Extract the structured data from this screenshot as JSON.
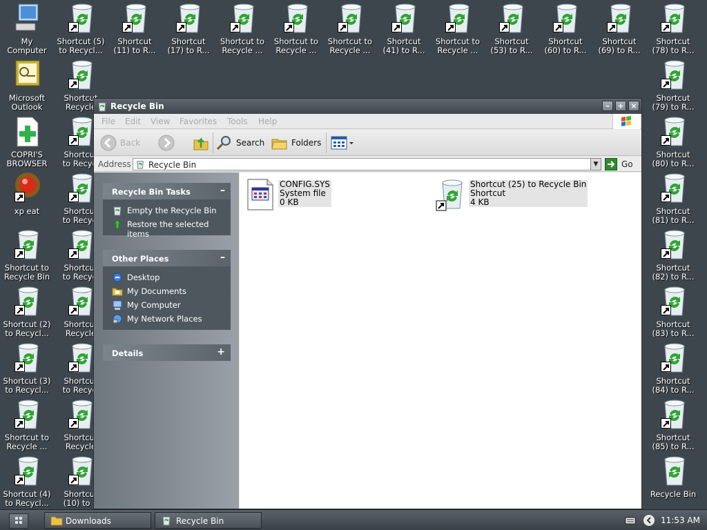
{
  "desktop": {
    "icons": [
      {
        "label": "My\nComputer"
      },
      {
        "label": "Microsoft\nOutlook"
      },
      {
        "label": "COPRI'S\nBROWSER"
      },
      {
        "label": "xp eat"
      },
      {
        "label": "Shortcut to\nRecycle Bin"
      },
      {
        "label": "Shortcut (2)\nto Recycl..."
      },
      {
        "label": "Shortcut (3)\nto Recycl..."
      },
      {
        "label": "Shortcut to\nRecycle ..."
      },
      {
        "label": "Shortcut (4)\nto Recycl..."
      },
      {
        "label": "Shortcut (5)\nto Recycl..."
      },
      {
        "label": "Shortcut\nRecycle"
      },
      {
        "label": "Shortcut\nto Recycl"
      },
      {
        "label": "Shortcut\nto Recycl"
      },
      {
        "label": "Shortcut\nto Recycl"
      },
      {
        "label": "Shortcut\nRecycle"
      },
      {
        "label": "Shortcut\nto Recycl"
      },
      {
        "label": "Shortcut\nRecycle"
      },
      {
        "label": "Shortcut\n(10) to R"
      },
      {
        "label": "Shortcut\n(11) to R..."
      },
      {
        "label": "Shortcut\n(17) to R..."
      },
      {
        "label": "Shortcut to\nRecycle ..."
      },
      {
        "label": "Shortcut to\nRecycle ..."
      },
      {
        "label": "Shortcut to\nRecycle ..."
      },
      {
        "label": "Shortcut\n(41) to R..."
      },
      {
        "label": "Shortcut to\nRecycle ..."
      },
      {
        "label": "Shortcut\n(53) to R..."
      },
      {
        "label": "Shortcut\n(60) to R..."
      },
      {
        "label": "Shortcut\n(69) to R..."
      },
      {
        "label": "Shortcut\n(78) to R..."
      },
      {
        "label": "Shortcut\n(79) to R..."
      },
      {
        "label": "Shortcut\n(80) to R..."
      },
      {
        "label": "Shortcut\n(81) to R..."
      },
      {
        "label": "Shortcut\n(82) to R..."
      },
      {
        "label": "Shortcut\n(83) to R..."
      },
      {
        "label": "Shortcut\n(84) to R..."
      },
      {
        "label": "Shortcut\n(85) to R..."
      },
      {
        "label": "Recycle Bin"
      }
    ]
  },
  "window": {
    "title": "Recycle Bin",
    "menu": [
      "File",
      "Edit",
      "View",
      "Favorites",
      "Tools",
      "Help"
    ],
    "toolbar": {
      "back": "Back",
      "search": "Search",
      "folders": "Folders"
    },
    "address": {
      "label": "Address",
      "value": "Recycle Bin",
      "go": "Go"
    },
    "panels": {
      "tasks": {
        "title": "Recycle Bin Tasks",
        "toggle": "–",
        "items": [
          "Empty the Recycle Bin",
          "Restore the selected items"
        ]
      },
      "places": {
        "title": "Other Places",
        "toggle": "–",
        "items": [
          "Desktop",
          "My Documents",
          "My Computer",
          "My Network Places"
        ]
      },
      "details": {
        "title": "Details",
        "toggle": "+"
      }
    },
    "files": [
      {
        "name": "CONFIG.SYS",
        "type": "System file",
        "size": "0 KB"
      },
      {
        "name": "Shortcut (25) to Recycle Bin",
        "type": "Shortcut",
        "size": "4 KB"
      }
    ]
  },
  "taskbar": {
    "buttons": [
      "Downloads",
      "Recycle Bin"
    ],
    "clock": "11:53 AM"
  },
  "colors": {
    "desktop_bg": "#3e464d",
    "panel_body": "#4f575e",
    "bin_green": "#2fa52f"
  }
}
